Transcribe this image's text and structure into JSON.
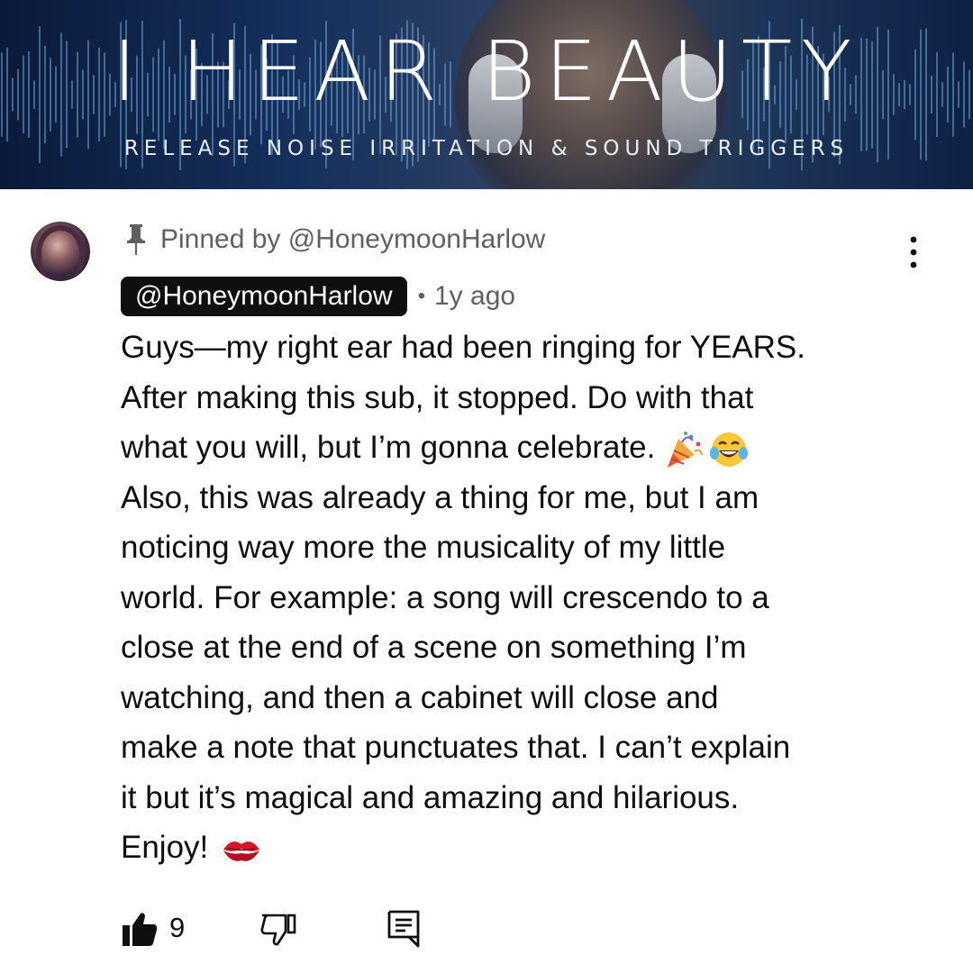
{
  "banner": {
    "headline": "I HEAR BEAUTY",
    "subline": "RELEASE NOISE IRRITATION & SOUND TRIGGERS"
  },
  "comment": {
    "pinned_label": "Pinned by @HoneymoonHarlow",
    "author": "@HoneymoonHarlow",
    "separator": "•",
    "timestamp": "1y ago",
    "lines": [
      "Guys—my right ear had been ringing for YEARS.",
      "After making this sub, it stopped. Do with that",
      "what you will, but I’m gonna celebrate.",
      "Also, this was already a thing for me, but I am",
      "noticing way more the musicality of my little",
      "world. For example: a song will crescendo to a",
      "close at the end of a scene on something I’m",
      "watching, and then a cabinet will close and",
      "make a note that punctuates that. I can’t explain",
      "it but it’s magical and amazing and hilarious.",
      "Enjoy!"
    ],
    "emojis": [
      "party-popper-emoji",
      "tears-of-joy-emoji",
      "kiss-mark-emoji"
    ],
    "like_count": "9"
  },
  "icons": {
    "pin": "pin-icon",
    "menu": "more-vertical-icon",
    "like": "thumbs-up-icon",
    "dislike": "thumbs-down-icon",
    "reply": "reply-comment-icon"
  },
  "colors": {
    "text": "#0f0f0f",
    "secondary_text": "#606060",
    "author_chip_bg": "#0f0f0f",
    "author_chip_text": "#ffffff",
    "banner_dark": "#0b1a3a",
    "banner_wave": "#6fa3d8"
  }
}
